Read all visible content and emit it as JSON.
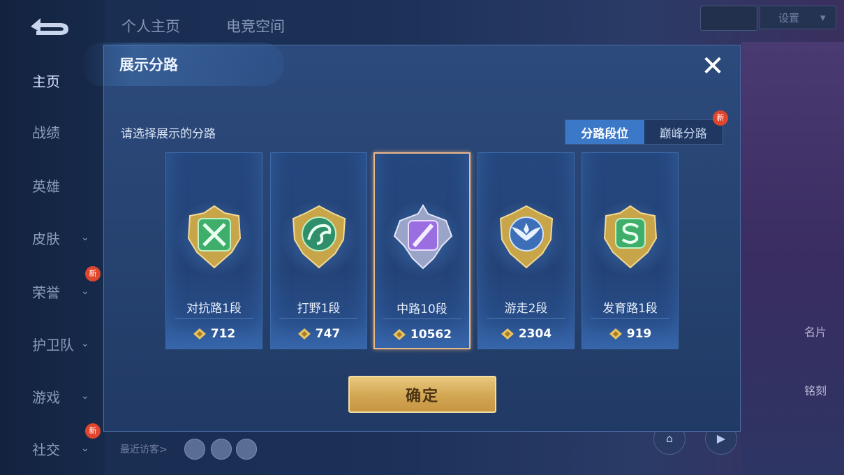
{
  "top_tabs": [
    "个人主页",
    "电竞空间"
  ],
  "top_right": {
    "select_label": "设置"
  },
  "sidebar": {
    "items": [
      {
        "label": "主页",
        "has_chevron": false,
        "is_new": false,
        "active": true
      },
      {
        "label": "战绩",
        "has_chevron": false,
        "is_new": false,
        "active": false
      },
      {
        "label": "英雄",
        "has_chevron": false,
        "is_new": false,
        "active": false
      },
      {
        "label": "皮肤",
        "has_chevron": true,
        "is_new": false,
        "active": false
      },
      {
        "label": "荣誉",
        "has_chevron": true,
        "is_new": true,
        "active": false
      },
      {
        "label": "护卫队",
        "has_chevron": true,
        "is_new": false,
        "active": false
      },
      {
        "label": "游戏",
        "has_chevron": true,
        "is_new": false,
        "active": false
      },
      {
        "label": "社交",
        "has_chevron": true,
        "is_new": true,
        "active": false
      }
    ],
    "new_badge": "新"
  },
  "bottom": {
    "recent_visitors_label": "最近访客>"
  },
  "right_panel": {
    "item1_label": "名片",
    "item2_label": "铭刻"
  },
  "modal": {
    "title": "展示分路",
    "prompt": "请选择展示的分路",
    "tabs": [
      {
        "label": "分路段位",
        "active": true,
        "is_new": false
      },
      {
        "label": "巅峰分路",
        "active": false,
        "is_new": true
      }
    ],
    "new_badge": "新",
    "cards": [
      {
        "label": "对抗路1段",
        "score": "712",
        "selected": false,
        "emblem": "sword-emblem-icon",
        "emblem_color": "#3fae6b"
      },
      {
        "label": "打野1段",
        "score": "747",
        "selected": false,
        "emblem": "dragon-emblem-icon",
        "emblem_color": "#2f8f6a"
      },
      {
        "label": "中路10段",
        "score": "10562",
        "selected": true,
        "emblem": "mage-crystal-emblem-icon",
        "emblem_color": "#9a6ee0"
      },
      {
        "label": "游走2段",
        "score": "2304",
        "selected": false,
        "emblem": "wings-emblem-icon",
        "emblem_color": "#4f8fd8"
      },
      {
        "label": "发育路1段",
        "score": "919",
        "selected": false,
        "emblem": "bow-emblem-icon",
        "emblem_color": "#3fae6b"
      }
    ],
    "confirm_label": "确定"
  },
  "colors": {
    "accent_blue": "#3c78c8",
    "gold": "#d2a652",
    "selected_border": "#e8b889"
  }
}
